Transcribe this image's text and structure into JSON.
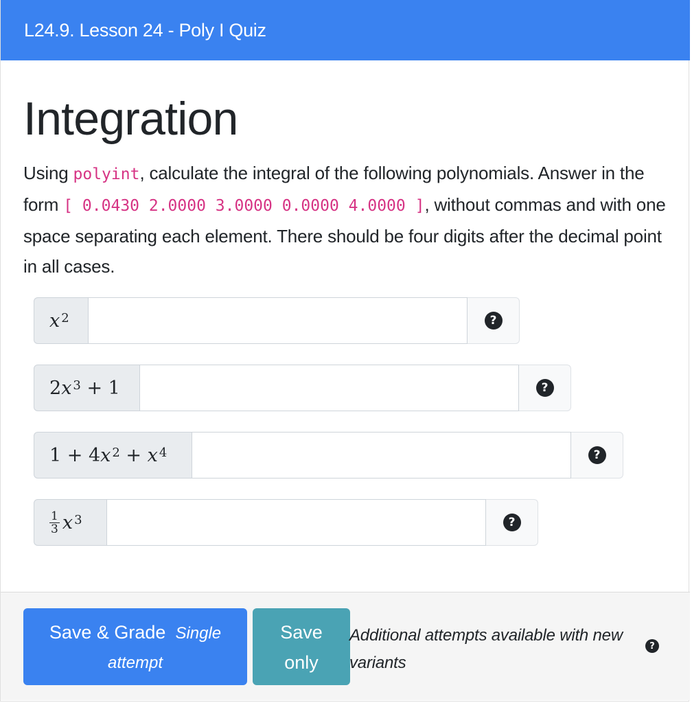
{
  "header": {
    "title": "L24.9. Lesson 24 - Poly I Quiz"
  },
  "question": {
    "title": "Integration",
    "prompt": {
      "part1": "Using ",
      "code1": "polyint",
      "part2": ", calculate the integral of the following polynomials. Answer in the form ",
      "code2": "[ 0.0430 2.0000 3.0000 0.0000 4.0000 ]",
      "part3": ", without commas and with one space separating each element. There should be four digits after the decimal point in all cases."
    },
    "inputs": [
      {
        "label": "x²",
        "value": "",
        "help_icon": "question-circle-icon"
      },
      {
        "label": "2x³ + 1",
        "value": "",
        "help_icon": "question-circle-icon"
      },
      {
        "label": "1 + 4x² + x⁴",
        "value": "",
        "help_icon": "question-circle-icon"
      },
      {
        "label": "1/3 x³",
        "value": "",
        "help_icon": "question-circle-icon"
      }
    ]
  },
  "footer": {
    "grade_button": {
      "label": "Save & Grade",
      "note_a": "Single",
      "note_b": "attempt"
    },
    "save_button": {
      "line1": "Save",
      "line2": "only"
    },
    "attempts_text": "Additional attempts available with new variants",
    "help_icon": "question-circle-icon"
  },
  "colors": {
    "header_bg": "#3a82f0",
    "grade_button_bg": "#3a82f0",
    "save_button_bg": "#4aa3b4",
    "code_text": "#d63384"
  }
}
